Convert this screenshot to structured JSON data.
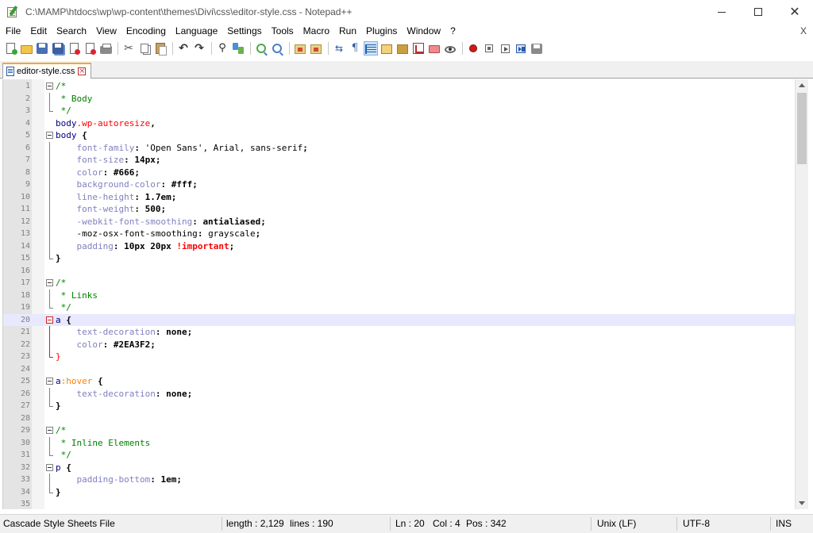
{
  "window": {
    "title": "C:\\MAMP\\htdocs\\wp\\wp-content\\themes\\Divi\\css\\editor-style.css - Notepad++",
    "minimize_glyph": "",
    "close_glyph": "✕"
  },
  "menu": {
    "items": [
      "File",
      "Edit",
      "Search",
      "View",
      "Encoding",
      "Language",
      "Settings",
      "Tools",
      "Macro",
      "Run",
      "Plugins",
      "Window",
      "?"
    ],
    "close_doc": "X"
  },
  "toolbar": {
    "buttons": [
      "new-file-icon",
      "open-file-icon",
      "save-icon",
      "save-all-icon",
      "close-file-icon",
      "close-all-icon",
      "print-icon",
      "|",
      "cut-icon",
      "copy-icon",
      "paste-icon",
      "|",
      "undo-icon",
      "redo-icon",
      "|",
      "find-icon",
      "replace-icon",
      "|",
      "zoom-in-icon",
      "zoom-out-icon",
      "|",
      "sync-vertical-icon",
      "sync-horizontal-icon",
      "|",
      "word-wrap-icon",
      "show-all-chars-icon",
      "indent-guide-icon",
      "udl-icon",
      "doc-map-icon",
      "function-list-icon",
      "folder-workspace-icon",
      "monitoring-icon",
      "|",
      "macro-record-icon",
      "macro-stop-icon",
      "macro-play-icon",
      "macro-run-multiple-icon",
      "macro-save-icon"
    ],
    "active": "indent-guide-icon"
  },
  "tab": {
    "label": "editor-style.css",
    "close_glyph": "×"
  },
  "editor": {
    "current_line": 20,
    "lines": [
      {
        "n": "1",
        "fold": "open",
        "tokens": [
          [
            "comment",
            "/*"
          ]
        ]
      },
      {
        "n": "2",
        "fold": "line",
        "tokens": [
          [
            "comment",
            " * Body"
          ]
        ]
      },
      {
        "n": "3",
        "fold": "end",
        "tokens": [
          [
            "comment",
            " */"
          ]
        ]
      },
      {
        "n": "4",
        "fold": "",
        "tokens": [
          [
            "tag",
            "body"
          ],
          [
            "class",
            ".wp-autoresize"
          ],
          [
            "op",
            ","
          ]
        ]
      },
      {
        "n": "5",
        "fold": "open",
        "tokens": [
          [
            "tag",
            "body"
          ],
          [
            "brace",
            " {"
          ]
        ]
      },
      {
        "n": "6",
        "fold": "line",
        "tokens": [
          [
            "prop",
            "    font-family"
          ],
          [
            "op",
            ": "
          ],
          [
            "valx",
            "'Open Sans', Arial, sans-serif"
          ],
          [
            "op",
            ";"
          ]
        ]
      },
      {
        "n": "7",
        "fold": "line",
        "tokens": [
          [
            "prop",
            "    font-size"
          ],
          [
            "op",
            ": "
          ],
          [
            "val",
            "14px"
          ],
          [
            "op",
            ";"
          ]
        ]
      },
      {
        "n": "8",
        "fold": "line",
        "tokens": [
          [
            "prop",
            "    color"
          ],
          [
            "op",
            ": "
          ],
          [
            "val",
            "#666"
          ],
          [
            "op",
            ";"
          ]
        ]
      },
      {
        "n": "9",
        "fold": "line",
        "tokens": [
          [
            "prop",
            "    background-color"
          ],
          [
            "op",
            ": "
          ],
          [
            "val",
            "#fff"
          ],
          [
            "op",
            ";"
          ]
        ]
      },
      {
        "n": "10",
        "fold": "line",
        "tokens": [
          [
            "prop",
            "    line-height"
          ],
          [
            "op",
            ": "
          ],
          [
            "val",
            "1.7em"
          ],
          [
            "op",
            ";"
          ]
        ]
      },
      {
        "n": "11",
        "fold": "line",
        "tokens": [
          [
            "prop",
            "    font-weight"
          ],
          [
            "op",
            ": "
          ],
          [
            "val",
            "500"
          ],
          [
            "op",
            ";"
          ]
        ]
      },
      {
        "n": "12",
        "fold": "line",
        "tokens": [
          [
            "prop",
            "    -webkit-font-smoothing"
          ],
          [
            "op",
            ": "
          ],
          [
            "val",
            "antialiased"
          ],
          [
            "op",
            ";"
          ]
        ]
      },
      {
        "n": "13",
        "fold": "line",
        "tokens": [
          [
            "propx",
            "    -moz-osx-font-smoothing"
          ],
          [
            "op",
            ": "
          ],
          [
            "valx",
            "grayscale"
          ],
          [
            "op",
            ";"
          ]
        ]
      },
      {
        "n": "14",
        "fold": "line",
        "tokens": [
          [
            "prop",
            "    padding"
          ],
          [
            "op",
            ": "
          ],
          [
            "val",
            "10px 20px "
          ],
          [
            "imp",
            "!important"
          ],
          [
            "op",
            ";"
          ]
        ]
      },
      {
        "n": "15",
        "fold": "end",
        "tokens": [
          [
            "brace",
            "}"
          ]
        ]
      },
      {
        "n": "16",
        "fold": "",
        "tokens": []
      },
      {
        "n": "17",
        "fold": "open",
        "tokens": [
          [
            "comment",
            "/*"
          ]
        ]
      },
      {
        "n": "18",
        "fold": "line",
        "tokens": [
          [
            "comment",
            " * Links"
          ]
        ]
      },
      {
        "n": "19",
        "fold": "end",
        "tokens": [
          [
            "comment",
            " */"
          ]
        ]
      },
      {
        "n": "20",
        "fold": "open-red",
        "tokens": [
          [
            "tag",
            "a"
          ],
          [
            "brace",
            " {"
          ]
        ]
      },
      {
        "n": "21",
        "fold": "line-red",
        "tokens": [
          [
            "prop",
            "    text-decoration"
          ],
          [
            "op",
            ": "
          ],
          [
            "val",
            "none"
          ],
          [
            "op",
            ";"
          ]
        ]
      },
      {
        "n": "22",
        "fold": "line-red",
        "tokens": [
          [
            "prop",
            "    color"
          ],
          [
            "op",
            ": "
          ],
          [
            "val",
            "#2EA3F2"
          ],
          [
            "op",
            ";"
          ]
        ]
      },
      {
        "n": "23",
        "fold": "end-red",
        "tokens": [
          [
            "class",
            "}"
          ]
        ]
      },
      {
        "n": "24",
        "fold": "",
        "tokens": []
      },
      {
        "n": "25",
        "fold": "open",
        "tokens": [
          [
            "tag",
            "a"
          ],
          [
            "pseudo",
            ":hover"
          ],
          [
            "brace",
            " {"
          ]
        ]
      },
      {
        "n": "26",
        "fold": "line",
        "tokens": [
          [
            "prop",
            "    text-decoration"
          ],
          [
            "op",
            ": "
          ],
          [
            "val",
            "none"
          ],
          [
            "op",
            ";"
          ]
        ]
      },
      {
        "n": "27",
        "fold": "end",
        "tokens": [
          [
            "brace",
            "}"
          ]
        ]
      },
      {
        "n": "28",
        "fold": "",
        "tokens": []
      },
      {
        "n": "29",
        "fold": "open",
        "tokens": [
          [
            "comment",
            "/*"
          ]
        ]
      },
      {
        "n": "30",
        "fold": "line",
        "tokens": [
          [
            "comment",
            " * Inline Elements"
          ]
        ]
      },
      {
        "n": "31",
        "fold": "end",
        "tokens": [
          [
            "comment",
            " */"
          ]
        ]
      },
      {
        "n": "32",
        "fold": "open",
        "tokens": [
          [
            "tag",
            "p"
          ],
          [
            "brace",
            " {"
          ]
        ]
      },
      {
        "n": "33",
        "fold": "line",
        "tokens": [
          [
            "prop",
            "    padding-bottom"
          ],
          [
            "op",
            ": "
          ],
          [
            "val",
            "1em"
          ],
          [
            "op",
            ";"
          ]
        ]
      },
      {
        "n": "34",
        "fold": "end",
        "tokens": [
          [
            "brace",
            "}"
          ]
        ]
      },
      {
        "n": "35",
        "fold": "",
        "tokens": []
      }
    ]
  },
  "status": {
    "file_type": "Cascade Style Sheets File",
    "length": "length : 2,129",
    "lines": "lines : 190",
    "ln": "Ln : 20",
    "col": "Col : 4",
    "pos": "Pos : 342",
    "eol": "Unix (LF)",
    "encoding": "UTF-8",
    "mode": "INS"
  },
  "colors": {
    "comment": "#008000",
    "tag": "#000080",
    "selector_class": "#ff0000",
    "pseudo": "#ff8000",
    "property": "#8080c0",
    "current_line_bg": "#e8e8ff",
    "tab_accent": "#f6a828"
  }
}
